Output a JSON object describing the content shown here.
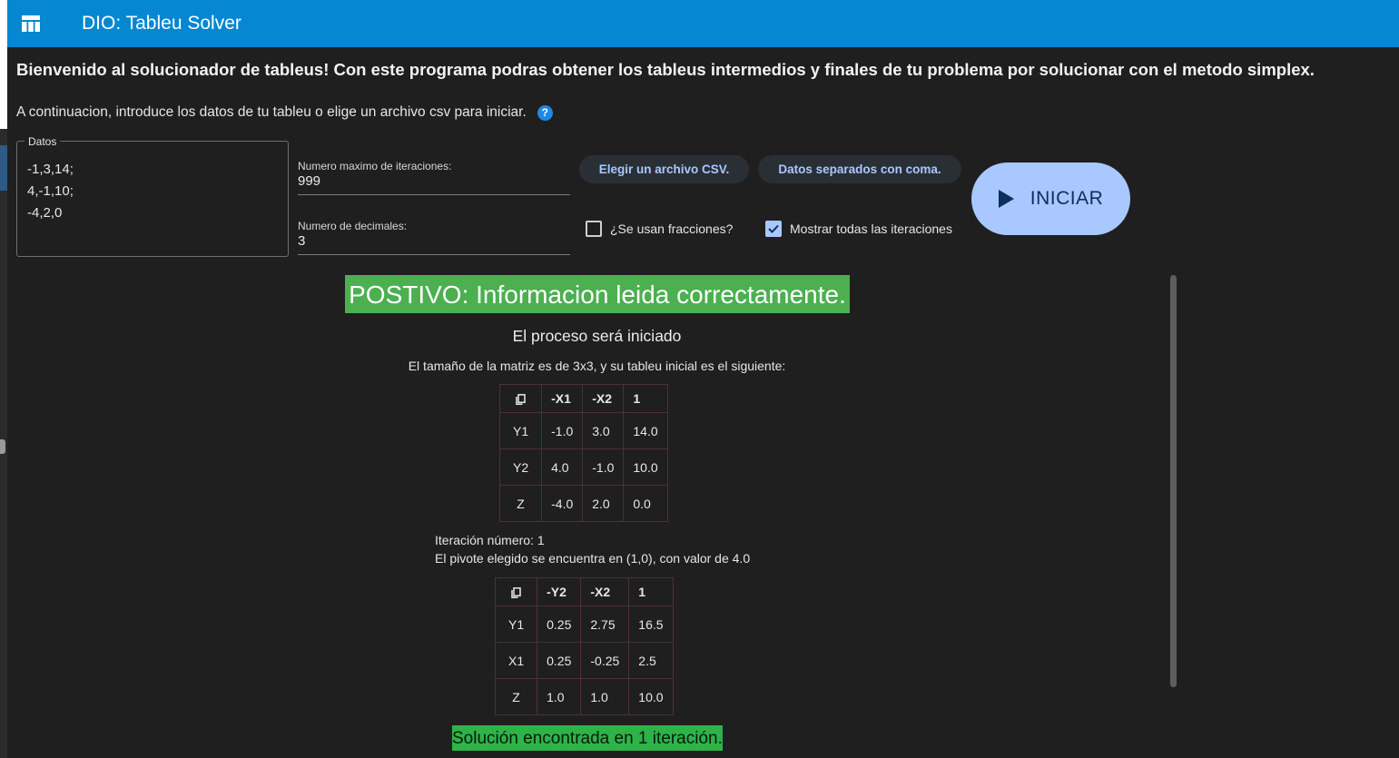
{
  "appbar": {
    "title": "DIO: Tableu Solver",
    "icon": "table-icon",
    "color": "#0587d2"
  },
  "welcome": "Bienvenido al solucionador de tableus! Con este programa podras obtener los tableus intermedios y finales de tu problema por solucionar con el metodo simplex.",
  "instruction": "A continuacion, introduce los datos de tu tableu o elige un archivo csv para iniciar.",
  "help_icon_text": "?",
  "datos": {
    "label": "Datos",
    "value": "-1,3,14;\n4,-1,10;\n-4,2,0"
  },
  "iteraciones": {
    "label": "Numero maximo de iteraciones:",
    "value": "999"
  },
  "decimales": {
    "label": "Numero de decimales:",
    "value": "3"
  },
  "buttons": {
    "csv": "Elegir un archivo CSV.",
    "coma": "Datos separados con coma.",
    "iniciar": "INICIAR"
  },
  "checkboxes": {
    "fracciones": {
      "label": "¿Se usan fracciones?",
      "checked": false
    },
    "todas": {
      "label": "Mostrar todas las iteraciones",
      "checked": true
    }
  },
  "results": {
    "status_positive": "POSTIVO: Informacion leida correctamente.",
    "process_started": "El proceso será iniciado",
    "size_text": "El tamaño de la matriz es de 3x3, y su tableu inicial es el siguiente:",
    "table1": {
      "headers": [
        "-X1",
        "-X2",
        "1"
      ],
      "rows": [
        {
          "label": "Y1",
          "cells": [
            "-1.0",
            "3.0",
            "14.0"
          ]
        },
        {
          "label": "Y2",
          "cells": [
            "4.0",
            "-1.0",
            "10.0"
          ]
        },
        {
          "label": "Z",
          "cells": [
            "-4.0",
            "2.0",
            "0.0"
          ]
        }
      ]
    },
    "iteration_text": "Iteración número: 1",
    "pivot_text": "El pivote elegido se encuentra en (1,0), con valor de 4.0",
    "table2": {
      "headers": [
        "-Y2",
        "-X2",
        "1"
      ],
      "rows": [
        {
          "label": "Y1",
          "cells": [
            "0.25",
            "2.75",
            "16.5"
          ]
        },
        {
          "label": "X1",
          "cells": [
            "0.25",
            "-0.25",
            "2.5"
          ]
        },
        {
          "label": "Z",
          "cells": [
            "1.0",
            "1.0",
            "10.0"
          ]
        }
      ]
    },
    "solution_text": "Solución encontrada en 1 iteración."
  },
  "colors": {
    "positive": "#4caf50",
    "solution": "#2eb34a",
    "accent": "#a8c8ff"
  }
}
